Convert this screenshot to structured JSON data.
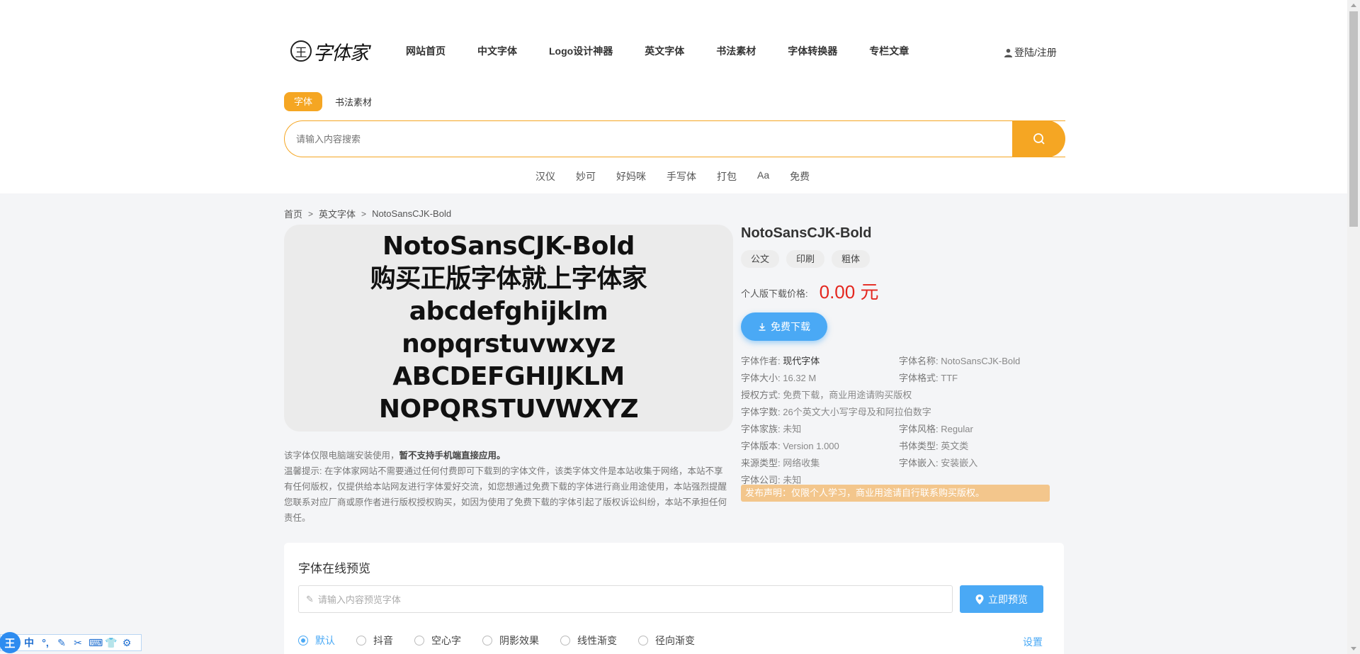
{
  "header": {
    "logo_mark": "王",
    "logo_text": "字体家",
    "nav": [
      "网站首页",
      "中文字体",
      "Logo设计神器",
      "英文字体",
      "书法素材",
      "字体转换器",
      "专栏文章"
    ],
    "login": "登陆/注册"
  },
  "search": {
    "tab_active": "字体",
    "tab_other": "书法素材",
    "placeholder": "请输入内容搜索",
    "hot": [
      "汉仪",
      "妙可",
      "好妈咪",
      "手写体",
      "打包",
      "Aa",
      "免费"
    ]
  },
  "breadcrumb": [
    "首页",
    "英文字体",
    "NotoSansCJK-Bold"
  ],
  "preview_lines": [
    "NotoSansCJK-Bold",
    "购买正版字体就上字体家",
    "abcdefghijklm",
    "nopqrstuvwxyz",
    "ABCDEFGHIJKLM",
    "NOPQRSTUVWXYZ"
  ],
  "info": {
    "title": "NotoSansCJK-Bold",
    "tags": [
      "公文",
      "印刷",
      "粗体"
    ],
    "price_label": "个人版下载价格:",
    "price_value": "0.00 元",
    "download_label": "免费下载",
    "meta": {
      "author_k": "字体作者:",
      "author_v": "现代字体",
      "name_k": "字体名称:",
      "name_v": "NotoSansCJK-Bold",
      "size_k": "字体大小:",
      "size_v": "16.32 M",
      "format_k": "字体格式:",
      "format_v": "TTF",
      "license_k": "授权方式:",
      "license_v": "免费下载，商业用途请购买版权",
      "chars_k": "字体字数:",
      "chars_v": "26个英文大小写字母及和阿拉伯数字",
      "family_k": "字体家族:",
      "family_v": "未知",
      "style_k": "字体风格:",
      "style_v": "Regular",
      "version_k": "字体版本:",
      "version_v": "Version 1.000",
      "type_k": "书体类型:",
      "type_v": "英文类",
      "source_k": "来源类型:",
      "source_v": "网络收集",
      "embed_k": "字体嵌入:",
      "embed_v": "安装嵌入",
      "company_k": "字体公司:",
      "company_v": "未知"
    },
    "notice": "发布声明：仅限个人学习，商业用途请自行联系购买版权。"
  },
  "tips": {
    "line1_a": "该字体仅限电脑端安装使用，",
    "line1_b": "暂不支持手机端直接应用。",
    "line2": "温馨提示:  在字体家网站不需要通过任何付费即可下载到的字体文件，该类字体文件是本站收集于网络，本站不享有任何版权，仅提供给本站网友进行字体爱好交流，如您想通过免费下载的字体进行商业用途使用，本站强烈提醒您联系对应厂商或原作者进行版权授权购买，如因为使用了免费下载的字体引起了版权诉讼纠纷，本站不承担任何责任。"
  },
  "online_preview": {
    "title": "字体在线预览",
    "placeholder": "请输入内容预览字体",
    "button": "立即预览",
    "options": [
      "默认",
      "抖音",
      "空心字",
      "阴影效果",
      "线性渐变",
      "径向渐变"
    ],
    "selected": "默认",
    "settings": "设置"
  },
  "ime": {
    "logo": "王",
    "items": [
      "中",
      "°,",
      "✎",
      "✂",
      "⌨",
      "👕",
      "⚙"
    ]
  },
  "colors": {
    "accent_orange": "#f5a623",
    "accent_blue": "#4aa9f5",
    "price_red": "#e4271f"
  }
}
